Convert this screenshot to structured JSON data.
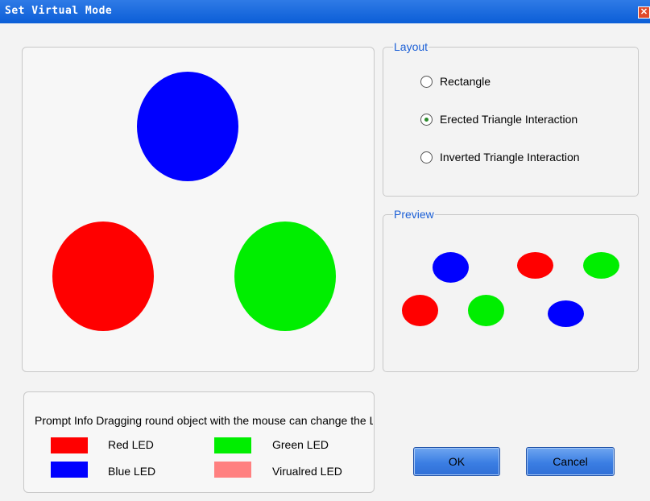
{
  "window": {
    "title": "Set Virtual Mode",
    "close_glyph": "✕"
  },
  "layout": {
    "legend": "Layout",
    "options": [
      {
        "label": "Rectangle",
        "checked": false
      },
      {
        "label": "Erected Triangle Interaction",
        "checked": true
      },
      {
        "label": "Inverted Triangle Interaction",
        "checked": false
      }
    ]
  },
  "preview": {
    "legend": "Preview"
  },
  "prompt": {
    "text": "Prompt Info Dragging round object with the mouse can change the LED layout",
    "legend_items": [
      {
        "label": "Red LED",
        "color": "#ff0000"
      },
      {
        "label": "Green LED",
        "color": "#00ee00"
      },
      {
        "label": "Blue LED",
        "color": "#0000ff"
      },
      {
        "label": "Virualred LED",
        "color": "#ff8080"
      }
    ]
  },
  "buttons": {
    "ok": "OK",
    "cancel": "Cancel"
  },
  "colors": {
    "red": "#ff0000",
    "green": "#00ee00",
    "blue": "#0000ff",
    "accent": "#1b5fd6"
  }
}
